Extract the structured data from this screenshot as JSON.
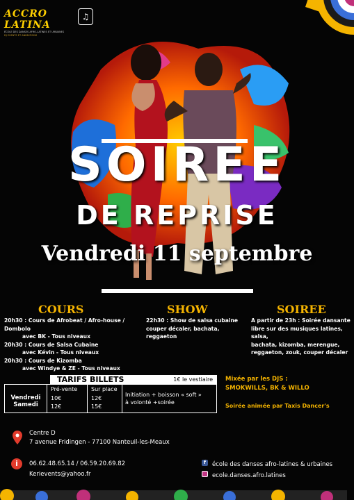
{
  "logo": {
    "main": "ACCRO LATINA",
    "sub": "ÉCOLE DES DANSES AFRO-LATINES ET URBAINES",
    "sub2": "DJ EVENTS ET ANIMATIONS"
  },
  "title": {
    "line1": "SOIREE",
    "line2": "DE REPRISE",
    "date": "Vendredi 11 septembre"
  },
  "cours": {
    "heading": "COURS",
    "lines": [
      "20h30 : Cours de Afrobeat / Afro-house / Dombolo",
      "avec BK - Tous niveaux",
      "20h30 : Cours de Salsa Cubaine",
      "avec Kévin - Tous niveaux",
      "20h30 : Cours de Kizomba",
      "avec Windye & ZE - Tous niveaux"
    ]
  },
  "show": {
    "heading": "SHOW",
    "lines": [
      "22h30 : Show de salsa cubaine",
      "couper décaler, bachata, reggaeton"
    ]
  },
  "soiree": {
    "heading": "SOIREE",
    "lines": [
      "A partir de 23h : Soirée dansante",
      "libre sur des musiques latines, salsa,",
      "bachata, kizomba, merengue,",
      "reggaeton, zouk, couper décaler"
    ]
  },
  "tarifs": {
    "heading": "TARIFS BILLETS",
    "vestiaire": "1€ le vestiaire",
    "day1": "Vendredi",
    "day2": "Samedi",
    "col_pre": "Pré-vente",
    "col_place": "Sur place",
    "pre_1": "10€",
    "place_1": "12€",
    "pre_2": "12€",
    "place_2": "15€",
    "offer_1": "Initiation + boisson « soft »",
    "offer_2": "à volonté +soirée"
  },
  "djs": {
    "line1": "Mixée par les DJS :",
    "line2": "SMOKWILLS, BK & WILLO",
    "anim": "Soirée animée par Taxis Dancer's"
  },
  "location": {
    "name": "Centre D",
    "address": "7 avenue Fridingen - 77100 Nanteuil-les-Meaux"
  },
  "contact": {
    "phones": "06.62.48.65.14  / 06.59.20.69.82",
    "email": "Kerievents@yahoo.fr"
  },
  "social": {
    "facebook": "école des danses afro-latines & urbaines",
    "instagram": "ecole.danses.afro.latines"
  },
  "icons": [
    "music-note-icon",
    "location-pin-icon",
    "info-icon",
    "facebook-icon",
    "instagram-icon"
  ],
  "colors": {
    "accent": "#f5b400",
    "background": "#000000",
    "pin": "#e23b2c"
  }
}
